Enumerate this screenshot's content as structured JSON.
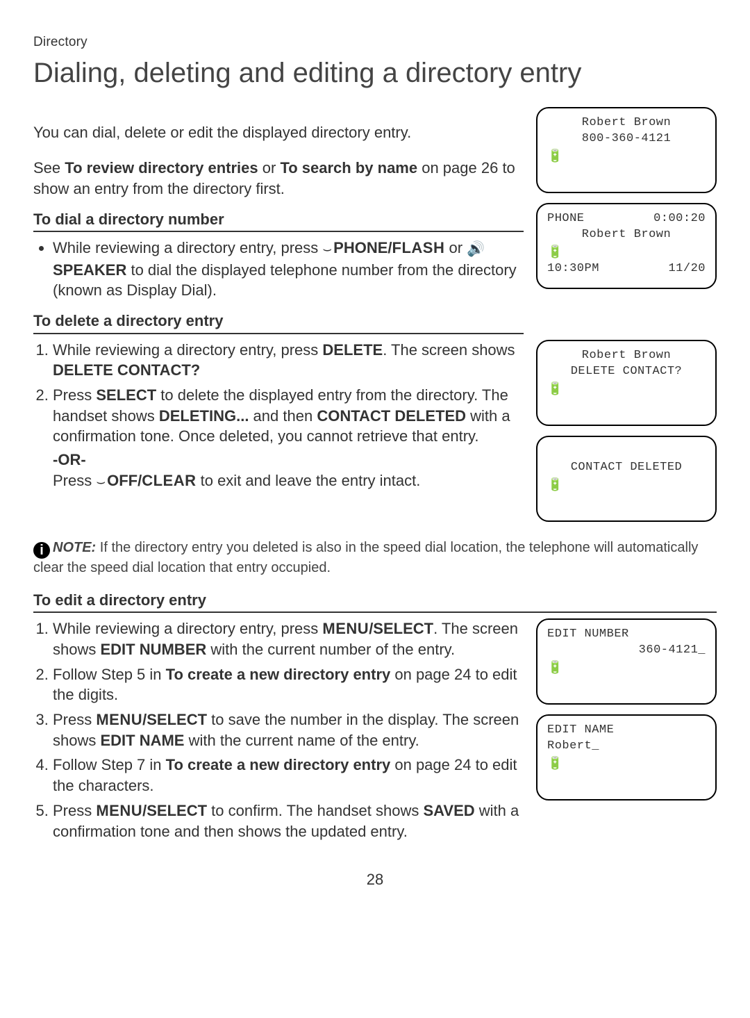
{
  "header": {
    "section": "Directory",
    "title": "Dialing, deleting and editing a directory entry"
  },
  "intro": {
    "line1": "You can dial, delete or edit the displayed directory entry.",
    "line2_pre": "See ",
    "ref1": "To review directory entries",
    "or": " or ",
    "ref2": "To search by name",
    "line2_post": " on page 26 to show an entry from the directory first."
  },
  "dial": {
    "heading": "To dial a directory number",
    "bullet_pre": "While reviewing a directory entry, press ",
    "btn1_icon": "⌣",
    "btn1_text": "PHONE/",
    "btn1_sc": "FLASH",
    "or": " or ",
    "btn2_icon": "🔊",
    "btn2_text": "SPEAKER",
    "bullet_post": " to dial the displayed telephone number from the directory (known as Display Dial)."
  },
  "deleteSec": {
    "heading": "To delete a directory entry",
    "step1_pre": "While reviewing a directory entry, press ",
    "step1_btn": "DELETE",
    "step1_mid": ". The screen shows ",
    "step1_bold": "DELETE CONTACT?",
    "step2_pre": "Press ",
    "step2_btn": "SELECT",
    "step2_mid": " to delete the displayed entry from the directory. The handset shows ",
    "step2_bold1": "DELETING...",
    "step2_mid2": " and then ",
    "step2_bold2": "CONTACT DELETED",
    "step2_post": " with a confirmation tone. Once deleted, you cannot retrieve that entry.",
    "or_label": "-OR-",
    "or_pre": "Press ",
    "or_icon": "⌣",
    "or_btn": "OFF/",
    "or_sc": "CLEAR",
    "or_post": " to exit and leave the entry intact."
  },
  "note": {
    "label": "NOTE:",
    "text": " If the directory entry you deleted is also in the speed dial location, the telephone will automatically clear the speed dial location that entry occupied."
  },
  "editSec": {
    "heading": "To edit a directory entry",
    "s1_pre": "While reviewing a directory entry, press ",
    "s1_sc": "MENU",
    "s1_btn": "/SELECT",
    "s1_mid": ". The screen shows ",
    "s1_bold": "EDIT NUMBER",
    "s1_post": " with the current number of the entry.",
    "s2_pre": "Follow Step 5 in ",
    "s2_ref": "To create a new directory entry",
    "s2_post": " on page 24 to edit the digits.",
    "s3_pre": "Press ",
    "s3_sc": "MENU",
    "s3_btn": "/SELECT",
    "s3_mid": " to save the number in the display. The screen shows ",
    "s3_bold": "EDIT NAME",
    "s3_post": " with the current name of the entry.",
    "s4_pre": "Follow Step 7 in ",
    "s4_ref": "To create a new directory entry",
    "s4_post": " on page 24 to edit the characters.",
    "s5_pre": "Press ",
    "s5_sc": "MENU",
    "s5_btn": "/SELECT",
    "s5_mid": " to confirm. The handset shows ",
    "s5_bold": "SAVED",
    "s5_post": " with a confirmation tone and then shows the updated entry."
  },
  "screens": {
    "entry": {
      "name": "Robert Brown",
      "number": "800-360-4121"
    },
    "dialing": {
      "status": "PHONE",
      "timer": "0:00:20",
      "name": "Robert Brown",
      "time": "10:30PM",
      "date": "11/20"
    },
    "confirm": {
      "name": "Robert Brown",
      "prompt": "DELETE CONTACT?"
    },
    "deleted": {
      "msg": "CONTACT DELETED"
    },
    "editnum": {
      "title": "EDIT NUMBER",
      "value": "360-4121_"
    },
    "editname": {
      "title": "EDIT NAME",
      "value": "Robert_"
    }
  },
  "battery_glyph": "🔋",
  "page_number": "28"
}
